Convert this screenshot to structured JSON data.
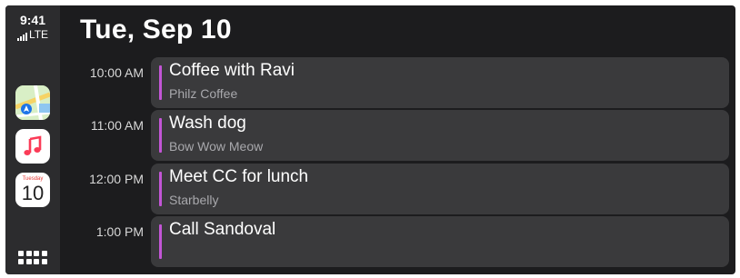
{
  "status": {
    "time": "9:41",
    "network": "LTE"
  },
  "dock": [
    {
      "app": "Maps",
      "icon": "maps-icon"
    },
    {
      "app": "Music",
      "icon": "music-note-icon"
    },
    {
      "app": "Calendar",
      "icon": "calendar-icon",
      "weekday": "Tuesday",
      "day": "10"
    }
  ],
  "header": {
    "title": "Tue, Sep 10"
  },
  "events": [
    {
      "time": "10:00 AM",
      "title": "Coffee with Ravi",
      "location": "Philz Coffee"
    },
    {
      "time": "11:00 AM",
      "title": "Wash dog",
      "location": "Bow Wow Meow"
    },
    {
      "time": "12:00 PM",
      "title": "Meet CC for lunch",
      "location": "Starbelly"
    },
    {
      "time": "1:00 PM",
      "title": "Call Sandoval",
      "location": ""
    }
  ],
  "colors": {
    "background": "#1c1c1e",
    "sidebar": "#2c2c2e",
    "card": "#3a3a3c",
    "calendar_accent": "#c355d6"
  }
}
